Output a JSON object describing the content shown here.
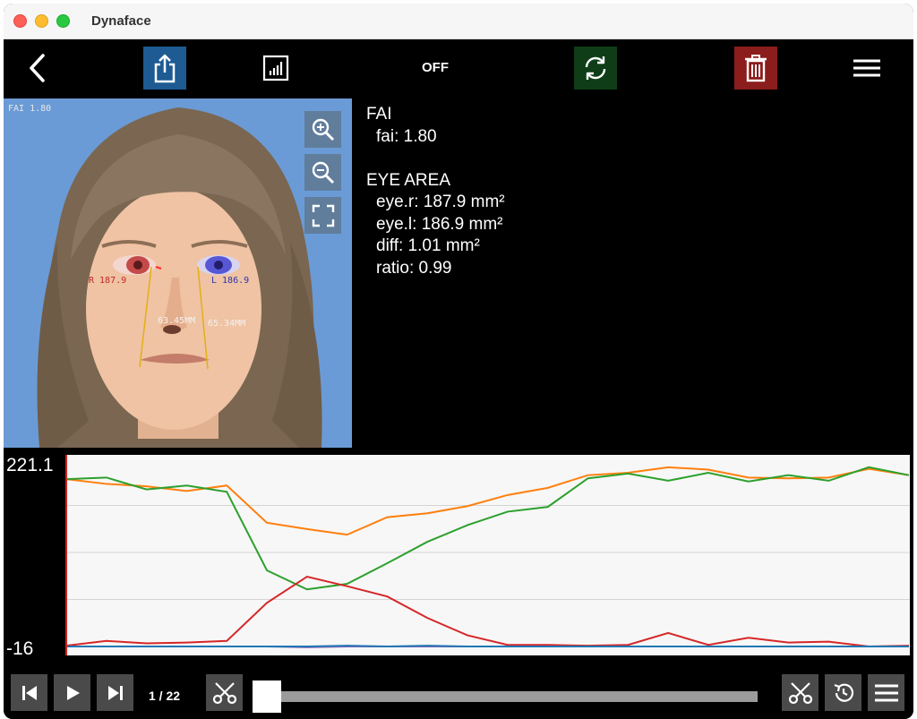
{
  "window": {
    "title": "Dynaface"
  },
  "toolbar": {
    "back_icon": "chevron-left-icon",
    "share_icon": "share-icon",
    "chart_icon": "bar-chart-icon",
    "off_label": "OFF",
    "refresh_icon": "refresh-icon",
    "delete_icon": "trash-icon",
    "menu_icon": "hamburger-menu-icon",
    "colors": {
      "share": "#1d5b92",
      "refresh": "#0e3d18",
      "delete": "#8c1d1d"
    }
  },
  "photo": {
    "fai_overlay": "FAI 1.80",
    "right_eye_label": "R 187.9",
    "left_eye_label": "L 186.9",
    "left_measure": "63.45MM",
    "right_measure": "65.34MM",
    "zoom_in_icon": "zoom-in-icon",
    "zoom_out_icon": "zoom-out-icon",
    "fullscreen_icon": "fullscreen-icon"
  },
  "measurements": {
    "fai_header": "FAI",
    "fai_value": "fai: 1.80",
    "eye_header": "EYE AREA",
    "eye_r": "eye.r: 187.9 mm²",
    "eye_l": "eye.l: 186.9 mm²",
    "diff": "diff:  1.01 mm²",
    "ratio": "ratio: 0.99"
  },
  "chart_data": {
    "type": "line",
    "ylim": [
      -16,
      221.1
    ],
    "ytick_labels": [
      "221.1",
      "-16"
    ],
    "grid": true,
    "x": [
      0,
      1,
      2,
      3,
      4,
      5,
      6,
      7,
      8,
      9,
      10,
      11,
      12,
      13,
      14,
      15,
      16,
      17,
      18,
      19,
      20,
      21
    ],
    "series": [
      {
        "color": "#ff7f0e",
        "values": [
          195,
          189,
          186,
          180,
          187,
          140,
          132,
          125,
          147,
          152,
          161,
          175,
          184,
          200,
          203,
          210,
          207,
          197,
          196,
          197,
          208,
          200
        ]
      },
      {
        "color": "#2ca02c",
        "values": [
          195,
          197,
          182,
          187,
          179,
          80,
          56,
          63,
          89,
          116,
          137,
          154,
          160,
          196,
          202,
          193,
          203,
          192,
          200,
          193,
          210,
          200
        ]
      },
      {
        "color": "#d62728",
        "values": [
          -15,
          -9,
          -12,
          -11,
          -9,
          39,
          72,
          60,
          47,
          20,
          -2,
          -14,
          -14,
          -15,
          -14,
          1,
          -14,
          -5,
          -11,
          -10,
          -16,
          -15
        ]
      },
      {
        "color": "#9467bd",
        "values": [
          -16,
          -16,
          -16,
          -16,
          -16,
          -16,
          -17,
          -16,
          -16,
          -16,
          -16,
          -16,
          -16,
          -16,
          -16,
          -16,
          -16,
          -16,
          -16,
          -16,
          -16,
          -16
        ]
      },
      {
        "color": "#1f77b4",
        "values": [
          -16,
          -16,
          -16,
          -16,
          -16,
          -16,
          -16,
          -15,
          -16,
          -15,
          -16,
          -16,
          -16,
          -16,
          -16,
          -16,
          -16,
          -16,
          -16,
          -16,
          -16,
          -16
        ]
      }
    ]
  },
  "playback": {
    "prev_icon": "skip-previous-icon",
    "play_icon": "play-icon",
    "next_icon": "skip-next-icon",
    "frame_label": "1 / 22",
    "current_frame": 1,
    "total_frames": 22,
    "cut_icon": "scissors-icon",
    "cut2_icon": "scissors-icon",
    "restore_icon": "restore-icon",
    "menu_icon": "hamburger-menu-icon"
  }
}
